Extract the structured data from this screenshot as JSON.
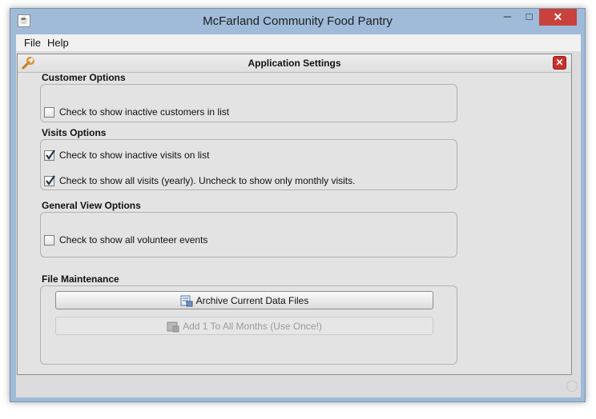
{
  "window": {
    "title": "McFarland Community Food Pantry",
    "minimize_glyph": "─",
    "maximize_glyph": "□",
    "close_glyph": "✕",
    "app_icon": "java-icon"
  },
  "menu": [
    {
      "label": "File"
    },
    {
      "label": "Help"
    }
  ],
  "dialog": {
    "title": "Application Settings",
    "icon": "wrench-icon",
    "close_glyph": "✕",
    "close_color": "#c9302c"
  },
  "sections": {
    "customer": {
      "label": "Customer Options",
      "options": [
        {
          "label": "Check to show inactive customers in list",
          "checked": false
        }
      ]
    },
    "visits": {
      "label": "Visits Options",
      "options": [
        {
          "label": "Check to show inactive visits on list",
          "checked": true
        },
        {
          "label": "Check to show all visits (yearly). Uncheck to show only monthly visits.",
          "checked": true
        }
      ]
    },
    "general": {
      "label": "General View Options",
      "options": [
        {
          "label": "Check to show all volunteer events",
          "checked": false
        }
      ]
    },
    "file_maintenance": {
      "label": "File Maintenance",
      "archive_button": "Archive Current Data Files",
      "add_button": "Add 1 To All Months (Use Once!)"
    }
  },
  "colors": {
    "window_frame": "#9fbbd9",
    "close_button": "#c8413c",
    "panel_bg": "#e3e3e3"
  }
}
